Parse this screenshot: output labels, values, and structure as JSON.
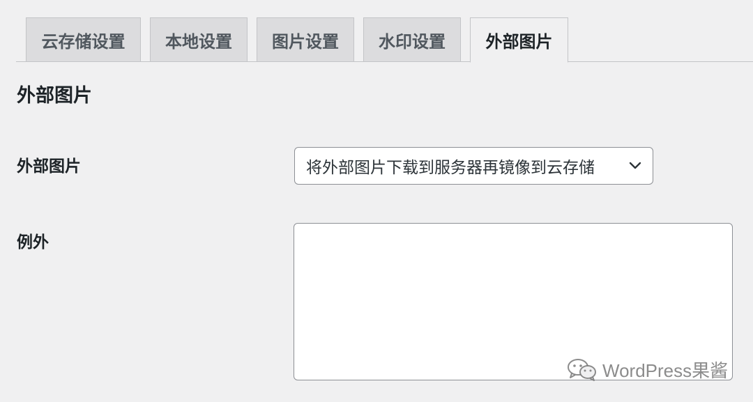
{
  "tabs": [
    {
      "label": "云存储设置",
      "active": false
    },
    {
      "label": "本地设置",
      "active": false
    },
    {
      "label": "图片设置",
      "active": false
    },
    {
      "label": "水印设置",
      "active": false
    },
    {
      "label": "外部图片",
      "active": true
    }
  ],
  "section": {
    "title": "外部图片"
  },
  "fields": {
    "external_images": {
      "label": "外部图片",
      "selected_value": "将外部图片下载到服务器再镜像到云存储"
    },
    "exceptions": {
      "label": "例外",
      "value": ""
    }
  },
  "watermark": {
    "text": "WordPress果酱"
  },
  "colors": {
    "background": "#f0f0f1",
    "tab_inactive_bg": "#dcdcde",
    "border": "#c3c4c7",
    "input_border": "#8c8f94",
    "text": "#1d2327"
  },
  "icons": {
    "select": "chevron-down-icon",
    "watermark": "wechat-icon"
  }
}
